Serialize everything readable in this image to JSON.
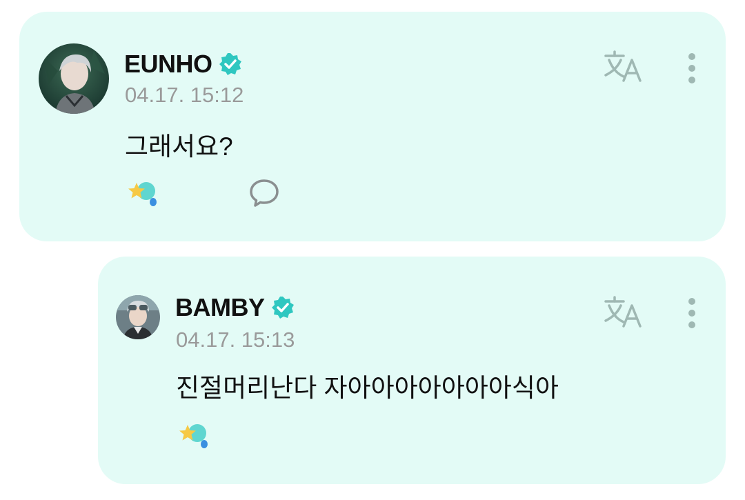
{
  "posts": [
    {
      "author": "EUNHO",
      "timestamp": "04.17. 15:12",
      "message": "그래서요?",
      "reaction_count": "",
      "icons": {
        "verified": "verified-badge-icon",
        "translate": "translate-icon",
        "more": "more-vertical-icon",
        "reaction": "star-reaction-icon",
        "comment": "comment-bubble-icon"
      }
    },
    {
      "author": "BAMBY",
      "timestamp": "04.17. 15:13",
      "message": "진절머리난다 자아아아아아아아식아",
      "reaction_count": "",
      "icons": {
        "verified": "verified-badge-icon",
        "translate": "translate-icon",
        "more": "more-vertical-icon",
        "reaction": "star-reaction-icon"
      }
    }
  ],
  "colors": {
    "card_background": "#e3fbf6",
    "verified": "#2fc7c0",
    "icon_gray": "#9fb8b3",
    "timestamp": "#9a9a9a"
  }
}
